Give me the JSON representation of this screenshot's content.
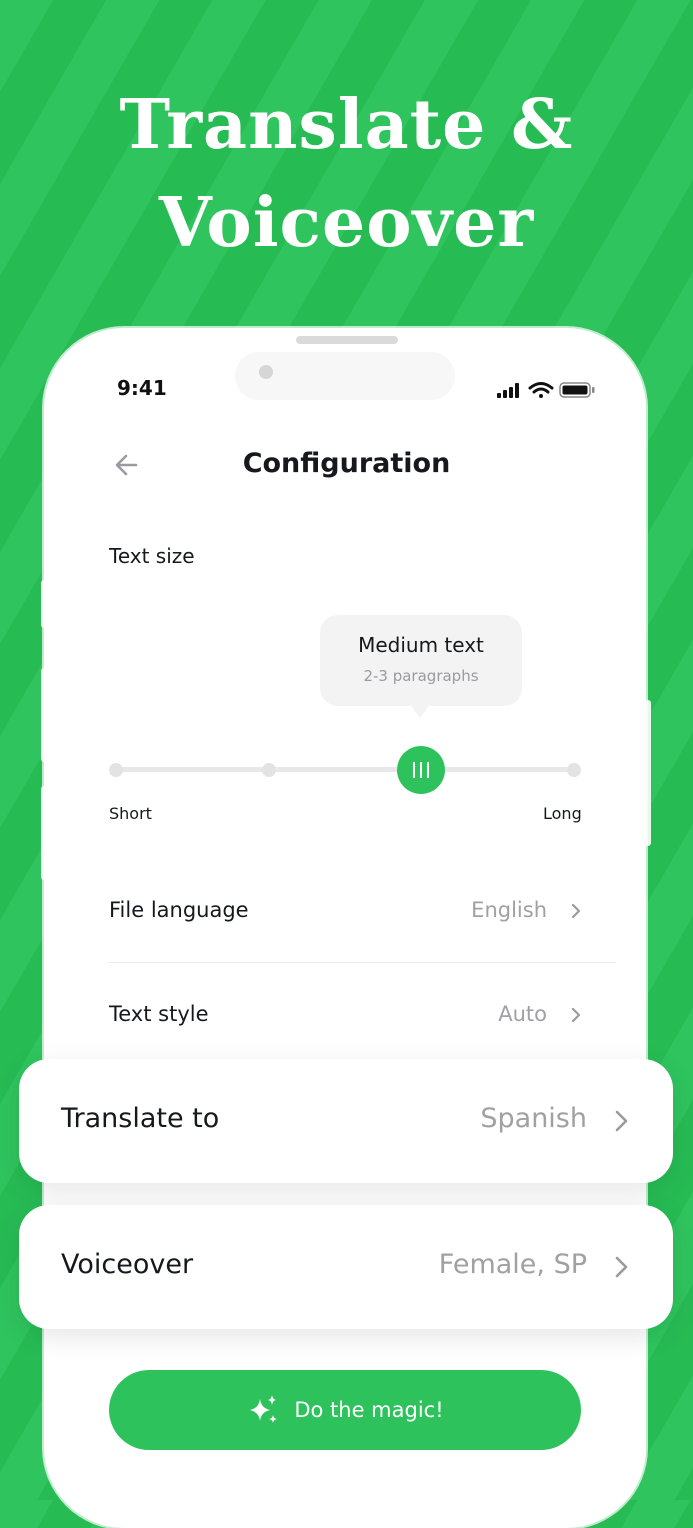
{
  "headline": {
    "line1": "Translate &",
    "line2": "Voiceover"
  },
  "status_bar": {
    "time": "9:41",
    "icons": [
      "signal-icon",
      "wifi-icon",
      "battery-icon"
    ]
  },
  "header": {
    "back_icon": "back-arrow-icon",
    "title": "Configuration"
  },
  "text_size": {
    "label": "Text size",
    "tooltip_title": "Medium text",
    "tooltip_subtitle": "2-3 paragraphs",
    "min_label": "Short",
    "max_label": "Long",
    "steps": 4,
    "selected_step": 3
  },
  "rows": [
    {
      "label": "File language",
      "value": "English"
    },
    {
      "label": "Text style",
      "value": "Auto"
    }
  ],
  "cards": [
    {
      "label": "Translate to",
      "value": "Spanish"
    },
    {
      "label": "Voiceover",
      "value": "Female, SP"
    }
  ],
  "action": {
    "label": "Do the magic!",
    "icon": "sparkles-icon"
  },
  "colors": {
    "accent": "#2dc25c",
    "background": "#2fc45e",
    "text": "#16181d",
    "muted": "#a0a0a5"
  }
}
